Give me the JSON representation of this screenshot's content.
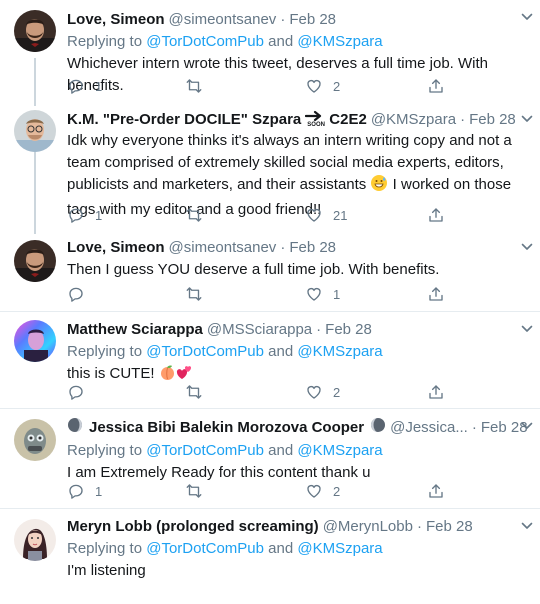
{
  "tweets": [
    {
      "name": "Love, Simeon",
      "handle": "@simeontsanev",
      "dot": "·",
      "date": "Feb 28",
      "replying_prefix": "Replying to",
      "replying_1": "@TorDotComPub",
      "replying_and": "and",
      "replying_2": "@KMSzpara",
      "text": "Whichever intern wrote this tweet, deserves a full time job. With benefits.",
      "replies": "1",
      "likes": "2",
      "avatar": "bearded-man-avatar"
    },
    {
      "name": "K.M. \"Pre-Order DOCILE\" Szpara",
      "name_suffix": "C2E2",
      "soon_label": "SOON",
      "handle": "@KMSzpara",
      "dot": "·",
      "date": "Feb 28",
      "text": "Idk why everyone thinks it's always an intern writing copy and not a team comprised of extremely skilled social media experts, editors, publicists and marketers, and their assistants",
      "text_after_emoji": "I worked on those tags with my editor and a good friend!!",
      "replies": "1",
      "likes": "21",
      "avatar": "glasses-man-avatar"
    },
    {
      "name": "Love, Simeon",
      "handle": "@simeontsanev",
      "dot": "·",
      "date": "Feb 28",
      "text": "Then I guess YOU deserve a full time job. With benefits.",
      "likes": "1",
      "avatar": "bearded-man-avatar"
    },
    {
      "name": "Matthew Sciarappa",
      "handle": "@MSSciarappa",
      "dot": "·",
      "date": "Feb 28",
      "replying_prefix": "Replying to",
      "replying_1": "@TorDotComPub",
      "replying_and": "and",
      "replying_2": "@KMSzpara",
      "text": "this is CUTE!",
      "likes": "2",
      "avatar": "colorful-man-avatar"
    },
    {
      "name": "Jessica Bibi Balekin Morozova Cooper",
      "handle": "@Jessica...",
      "dot": "·",
      "date": "Feb 28",
      "replying_prefix": "Replying to",
      "replying_1": "@TorDotComPub",
      "replying_and": "and",
      "replying_2": "@KMSzpara",
      "text": "I am Extremely Ready for this content thank u",
      "replies": "1",
      "likes": "2",
      "avatar": "masked-person-avatar"
    },
    {
      "name": "Meryn Lobb (prolonged screaming)",
      "handle": "@MerynLobb",
      "dot": "·",
      "date": "Feb 28",
      "replying_prefix": "Replying to",
      "replying_1": "@TorDotComPub",
      "replying_and": "and",
      "replying_2": "@KMSzpara",
      "text": "I'm listening",
      "avatar": "illustrated-woman-avatar"
    }
  ],
  "colors": {
    "link": "#1da1f2",
    "muted": "#657786",
    "text": "#14171a",
    "separator": "#e6ecf0",
    "thread_line": "#ccd6dd"
  },
  "icons": [
    "reply-icon",
    "retweet-icon",
    "like-icon",
    "share-icon",
    "caret-down-icon",
    "moon-icon",
    "peach-emoji",
    "hearts-emoji",
    "grinning-sweat-emoji",
    "soon-arrow-icon"
  ]
}
